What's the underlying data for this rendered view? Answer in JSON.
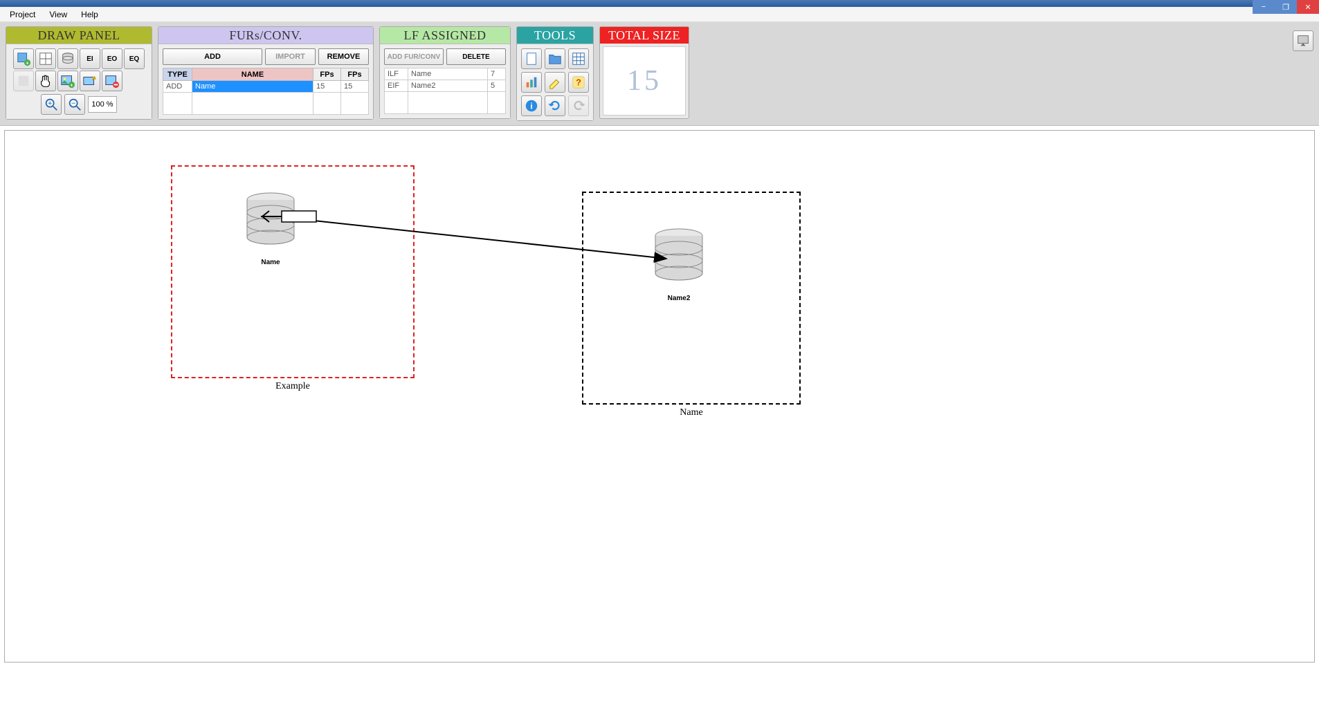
{
  "window": {
    "min_icon": "−",
    "max_icon": "❐",
    "close_icon": "✕"
  },
  "menu": {
    "project": "Project",
    "view": "View",
    "help": "Help"
  },
  "panels": {
    "draw": "DRAW PANEL",
    "furs": "FURs/CONV.",
    "lf": "LF ASSIGNED",
    "tools": "TOOLS",
    "size": "TOTAL SIZE"
  },
  "draw_icons": {
    "ei": "EI",
    "eo": "EO",
    "eq": "EQ"
  },
  "zoom": {
    "value": "100 %"
  },
  "furs": {
    "add": "ADD",
    "import": "IMPORT",
    "remove": "REMOVE",
    "cols": {
      "type": "TYPE",
      "name": "NAME",
      "fps1": "FPs",
      "fps2": "FPs"
    },
    "rows": [
      {
        "type": "ADD",
        "name": "Name",
        "fp1": "15",
        "fp2": "15",
        "selected": true
      }
    ]
  },
  "lf": {
    "add": "ADD FUR/CONV",
    "delete": "DELETE",
    "rows": [
      {
        "c1": "ILF",
        "c2": "Name",
        "c3": "7"
      },
      {
        "c1": "EIF",
        "c2": "Name2",
        "c3": "5"
      }
    ]
  },
  "total_size": "15",
  "canvas": {
    "boundary1": {
      "label": "Example"
    },
    "boundary2": {
      "label": "Name"
    },
    "node1": {
      "label": "Name"
    },
    "node2": {
      "label": "Name2"
    }
  }
}
